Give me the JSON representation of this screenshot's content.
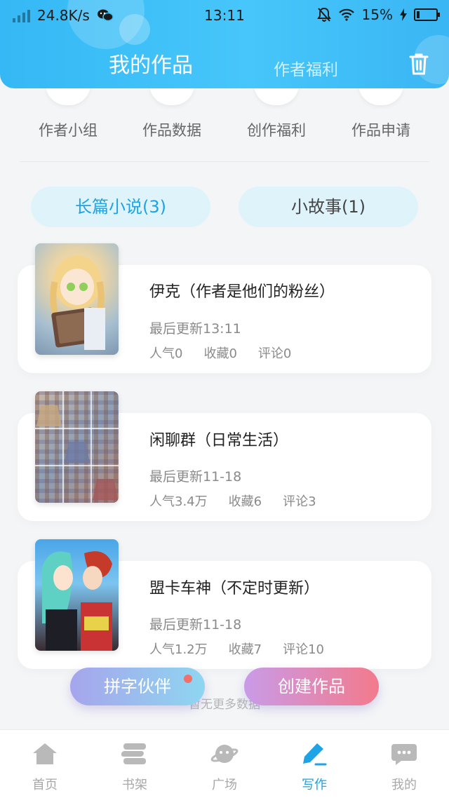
{
  "status_bar": {
    "speed": "24.8K/s",
    "time": "13:11",
    "battery": "15%",
    "battery_level": 0.15
  },
  "header": {
    "title": "我的作品",
    "sub_tab": "作者福利",
    "delete_icon": "trash-icon"
  },
  "quick_actions": [
    {
      "label": "作者小组"
    },
    {
      "label": "作品数据"
    },
    {
      "label": "创作福利"
    },
    {
      "label": "作品申请"
    }
  ],
  "category_tabs": [
    {
      "label": "长篇小说(3)",
      "active": true
    },
    {
      "label": "小故事(1)",
      "active": false
    }
  ],
  "works": [
    {
      "title": "伊克（作者是他们的粉丝）",
      "update": "最后更新13:11",
      "popularity": "人气0",
      "favorites": "收藏0",
      "comments": "评论0"
    },
    {
      "title": "闲聊群（日常生活）",
      "update": "最后更新11-18",
      "popularity": "人气3.4万",
      "favorites": "收藏6",
      "comments": "评论3"
    },
    {
      "title": "盟卡车神（不定时更新）",
      "update": "最后更新11-18",
      "popularity": "人气1.2万",
      "favorites": "收藏7",
      "comments": "评论10"
    }
  ],
  "footer_text": "暂无更多数据",
  "floating_buttons": {
    "partner": "拼字伙伴",
    "create": "创建作品"
  },
  "bottom_nav": [
    {
      "label": "首页",
      "icon": "home-icon"
    },
    {
      "label": "书架",
      "icon": "bookshelf-icon"
    },
    {
      "label": "广场",
      "icon": "planet-icon"
    },
    {
      "label": "写作",
      "icon": "pen-icon",
      "active": true
    },
    {
      "label": "我的",
      "icon": "chat-bubble-icon"
    }
  ],
  "colors": {
    "accent": "#1da3e6",
    "header_blue": "#3ab6f4",
    "create_pink": "#f37a8c"
  }
}
